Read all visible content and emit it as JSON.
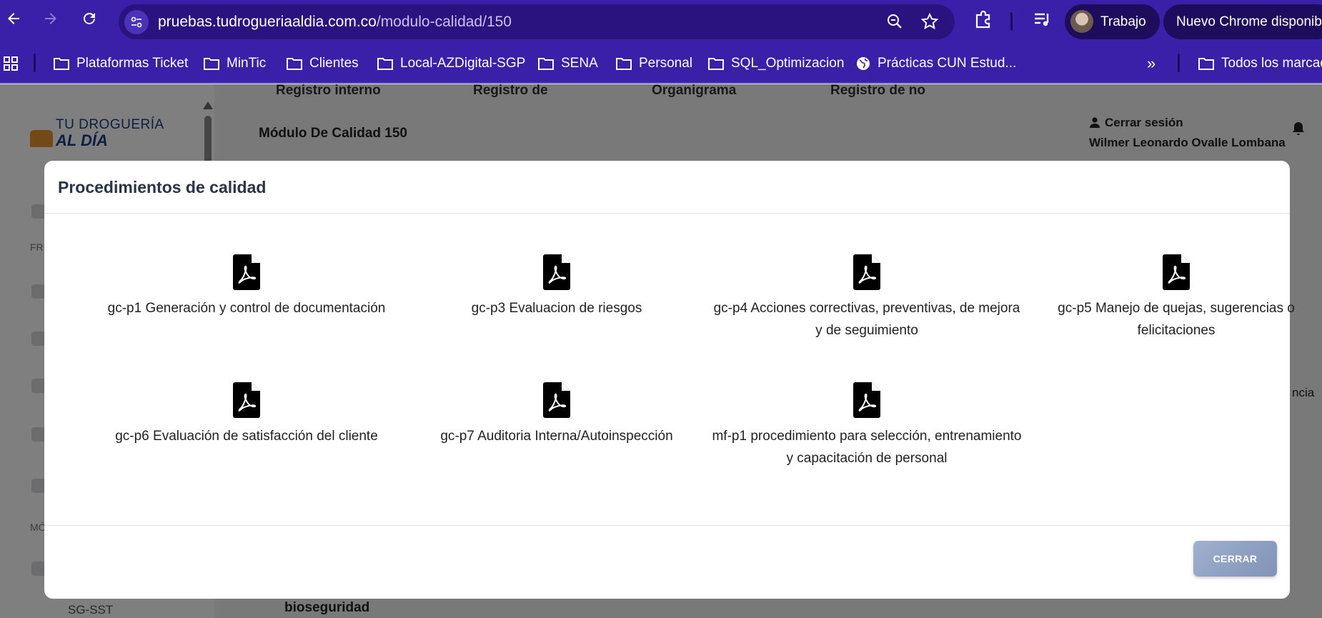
{
  "browser": {
    "url_host": "pruebas.tudrogueriaaldia.com.co",
    "url_path": "/modulo-calidad/150",
    "profile_name": "Trabajo",
    "update_label": "Nuevo Chrome disponible",
    "bookmarks": [
      "Plataformas Ticket",
      "MinTic",
      "Clientes",
      "Local-AZDigital-SGP",
      "SENA",
      "Personal",
      "SQL_Optimizacion",
      "Prácticas CUN Estud...",
      "Todos los marcad"
    ]
  },
  "page": {
    "logo_line1": "TU DROGUERÍA",
    "logo_line2": "AL DÍA",
    "nav_items": [
      "Registro interno",
      "Registro de",
      "Organigrama",
      "Registro de no"
    ],
    "title": "Módulo De Calidad 150",
    "logout_label": "Cerrar sesión",
    "user_name": "Wilmer Leonardo Ovalle Lombana",
    "sidebar_label_1": "FR",
    "sidebar_label_2": "MÓ",
    "sidebar_bottom_item": "SG-SST",
    "bottom_card_title": "bioseguridad",
    "partial_text": "ncia"
  },
  "modal": {
    "title": "Procedimientos de calidad",
    "documents": [
      {
        "label": "gc-p1 Generación y control de documentación",
        "icon": "pdf-file-icon"
      },
      {
        "label": "gc-p3 Evaluacion de riesgos",
        "icon": "pdf-file-icon"
      },
      {
        "label": "gc-p4 Acciones correctivas, preventivas, de mejora y de seguimiento",
        "icon": "pdf-file-icon"
      },
      {
        "label": "gc-p5 Manejo de quejas, sugerencias o felicitaciones",
        "icon": "pdf-file-icon"
      },
      {
        "label": "gc-p6 Evaluación de satisfacción del cliente",
        "icon": "pdf-file-icon"
      },
      {
        "label": "gc-p7 Auditoria Interna/Autoinspección",
        "icon": "pdf-file-icon"
      },
      {
        "label": "mf-p1 procedimiento para selección, entrenamiento y capacitación de personal",
        "icon": "pdf-file-icon"
      }
    ],
    "close_label": "CERRAR"
  },
  "colors": {
    "chrome_bg": "#3a1fa8",
    "close_button": "#8fa1c4"
  }
}
